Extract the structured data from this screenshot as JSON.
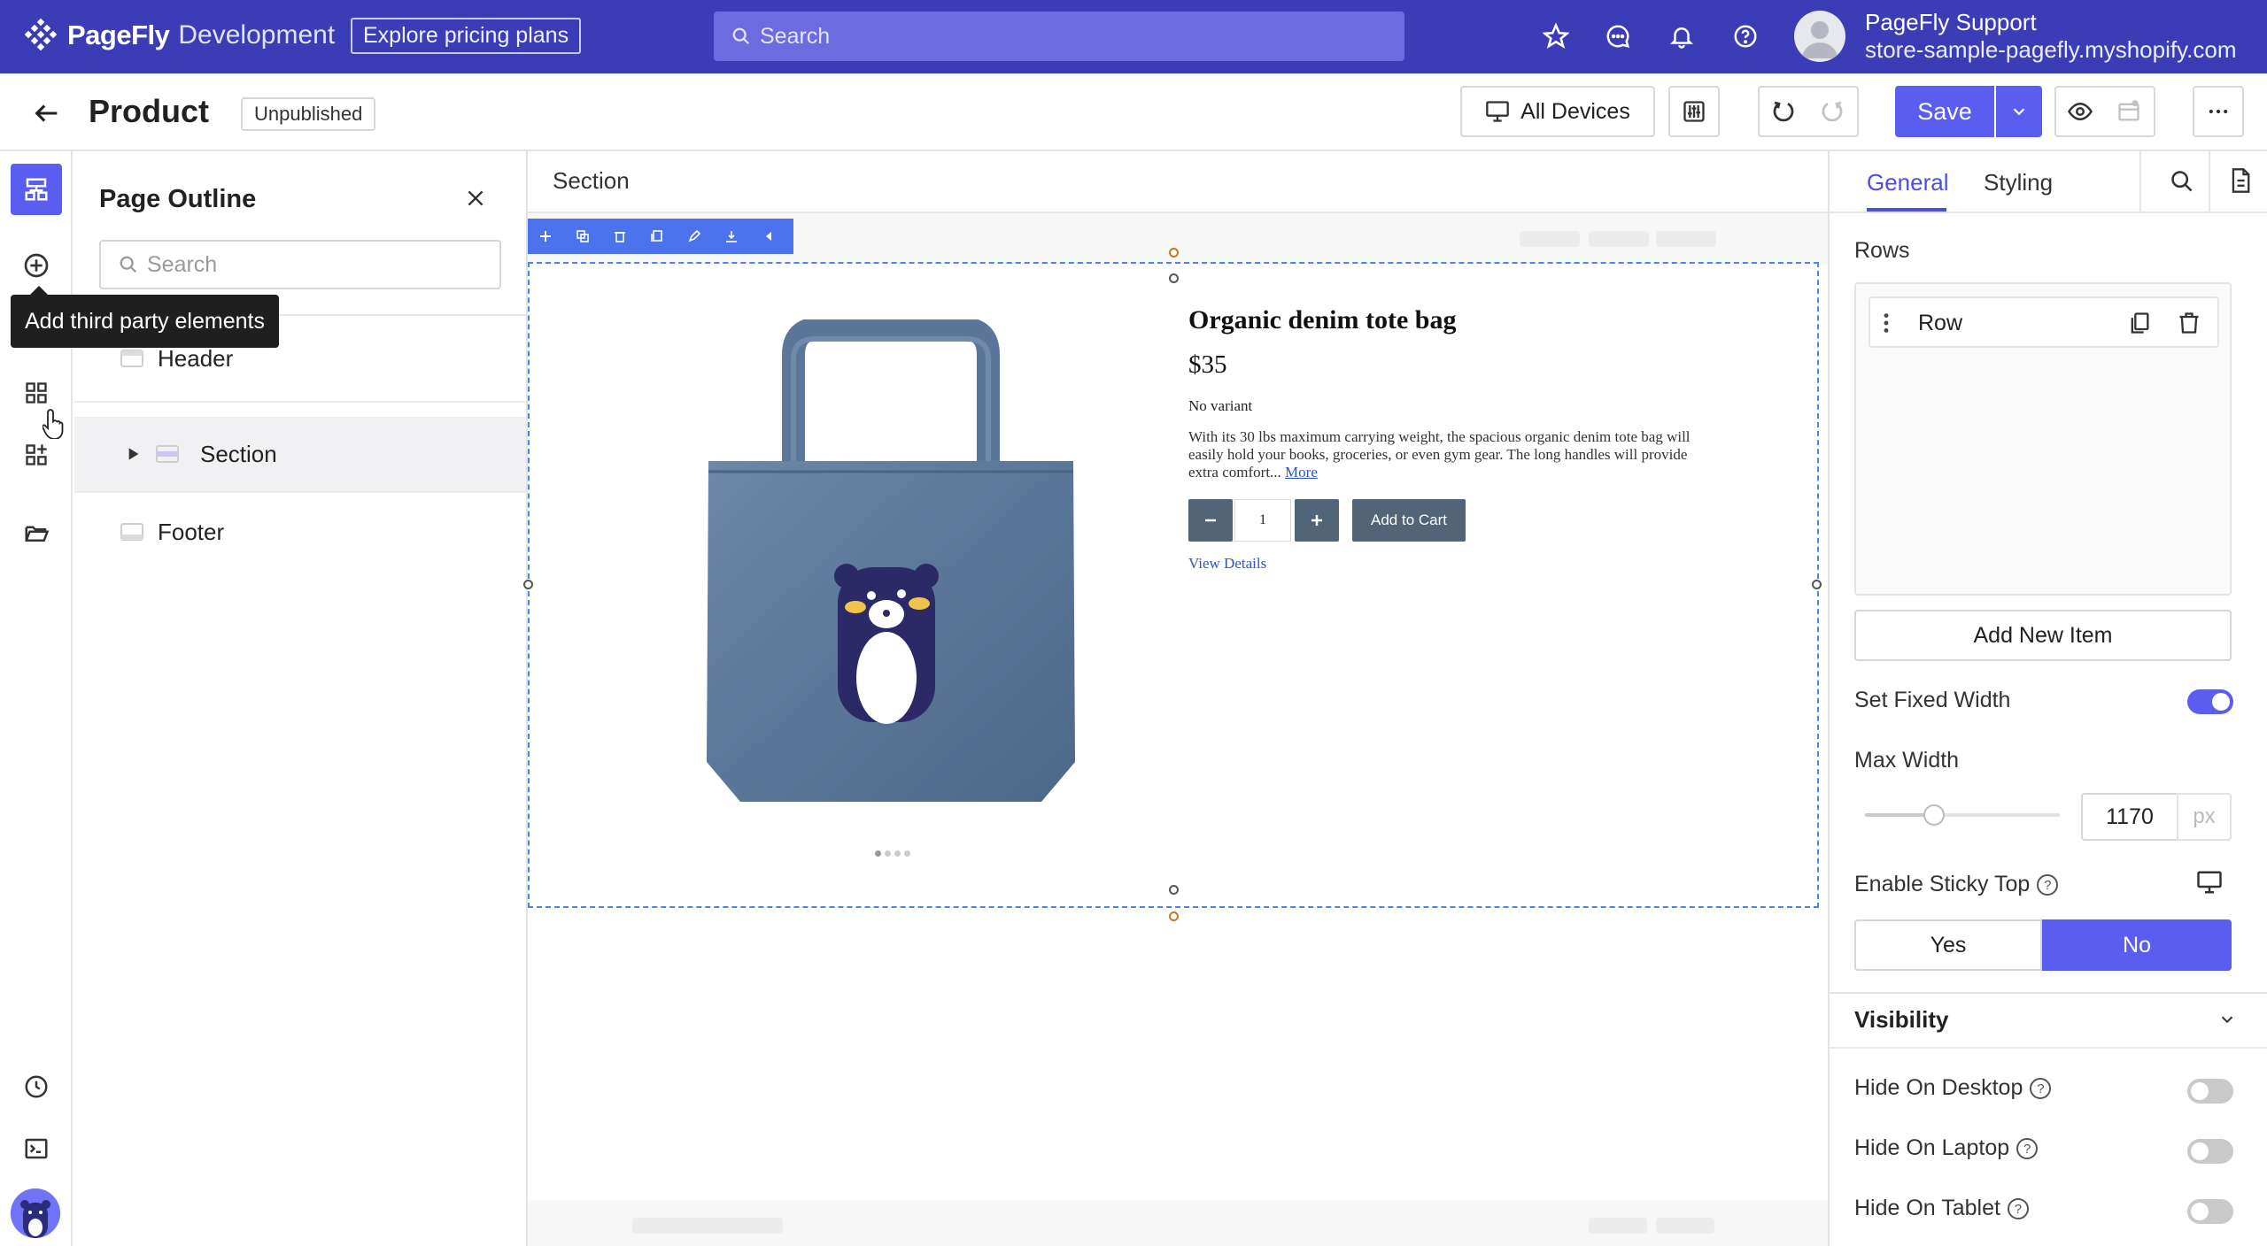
{
  "topbar": {
    "logo": "PageFly",
    "environment": "Development",
    "pricing_label": "Explore pricing plans",
    "search_placeholder": "Search",
    "user_name": "PageFly Support",
    "user_store": "store-sample-pagefly.myshopify.com"
  },
  "header": {
    "title": "Product",
    "status": "Unpublished",
    "devices_label": "All Devices",
    "save_label": "Save"
  },
  "rail": {
    "tooltip": "Add third party elements"
  },
  "outline": {
    "title": "Page Outline",
    "search_placeholder": "Search",
    "items": [
      {
        "label": "Header"
      },
      {
        "label": "Section"
      },
      {
        "label": "Footer"
      }
    ]
  },
  "canvas": {
    "header_label": "Section",
    "product": {
      "title": "Organic denim tote bag",
      "price": "$35",
      "variant": "No variant",
      "description": "With its 30 lbs maximum carrying weight, the spacious organic denim tote bag will easily hold your books, groceries, or even gym gear. The long handles will provide extra comfort...",
      "more_link": "More",
      "quantity": "1",
      "add_to_cart": "Add to Cart",
      "view_details": "View Details"
    }
  },
  "inspector": {
    "tabs": [
      "General",
      "Styling"
    ],
    "rows_label": "Rows",
    "row_item": "Row",
    "add_item": "Add New Item",
    "fixed_width_label": "Set Fixed Width",
    "fixed_width_on": true,
    "max_width_label": "Max Width",
    "max_width_value": "1170",
    "max_width_unit": "px",
    "sticky_label": "Enable Sticky Top",
    "sticky_yes": "Yes",
    "sticky_no": "No",
    "visibility_title": "Visibility",
    "visibility_items": [
      {
        "label": "Hide On Desktop",
        "on": false
      },
      {
        "label": "Hide On Laptop",
        "on": false
      },
      {
        "label": "Hide On Tablet",
        "on": false
      }
    ]
  },
  "colors": {
    "topbar": "#3b3db6",
    "accent": "#5a5ef0",
    "selection": "#4a86e8"
  }
}
